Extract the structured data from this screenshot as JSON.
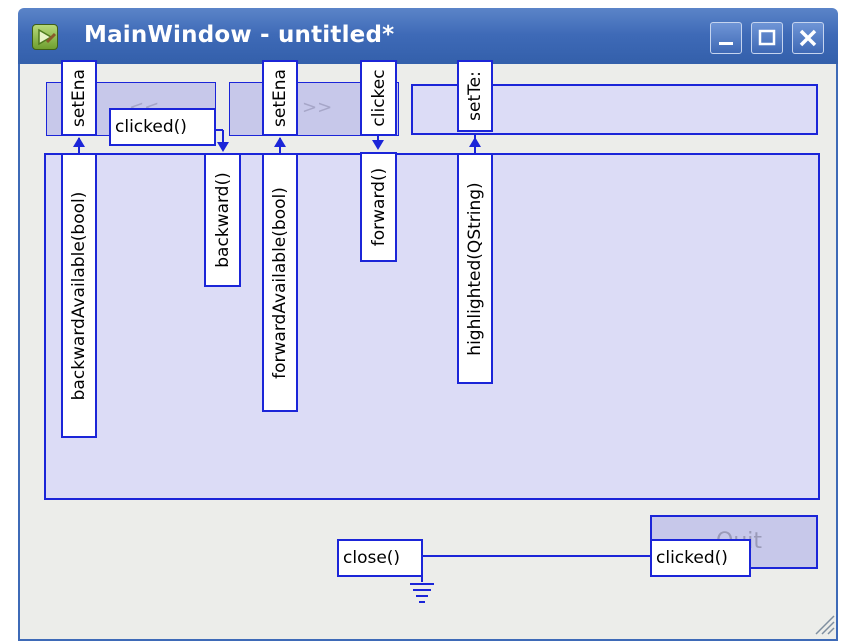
{
  "window": {
    "title": "MainWindow - untitled*",
    "buttons": {
      "minimize": "minimize",
      "maximize": "maximize",
      "close": "close"
    }
  },
  "widgets": {
    "back_button_text": "<<",
    "forward_button_text": ">>",
    "quit_button_text": "Quit"
  },
  "connections": {
    "set_enabled_1": "setEna",
    "backward_available": "backwardAvailable(bool)",
    "clicked_back": "clicked()",
    "backward": "backward()",
    "set_enabled_2": "setEna",
    "forward_available": "forwardAvailable(bool)",
    "clicked_forward": "clickec",
    "forward": "forward()",
    "set_text": "setTe:",
    "highlighted": "highlighted(QString)",
    "close": "close()",
    "clicked_quit": "clicked()"
  },
  "colors": {
    "connection": "#1b25d8",
    "widget_fill": "#dcdcf6",
    "button_fill": "#c7c8ea",
    "form_background": "#ecedea",
    "titlebar": "#3e6ab7"
  },
  "icons": [
    "app-icon",
    "minimize-icon",
    "maximize-icon",
    "close-icon",
    "ground-icon",
    "resize-grip-icon"
  ]
}
